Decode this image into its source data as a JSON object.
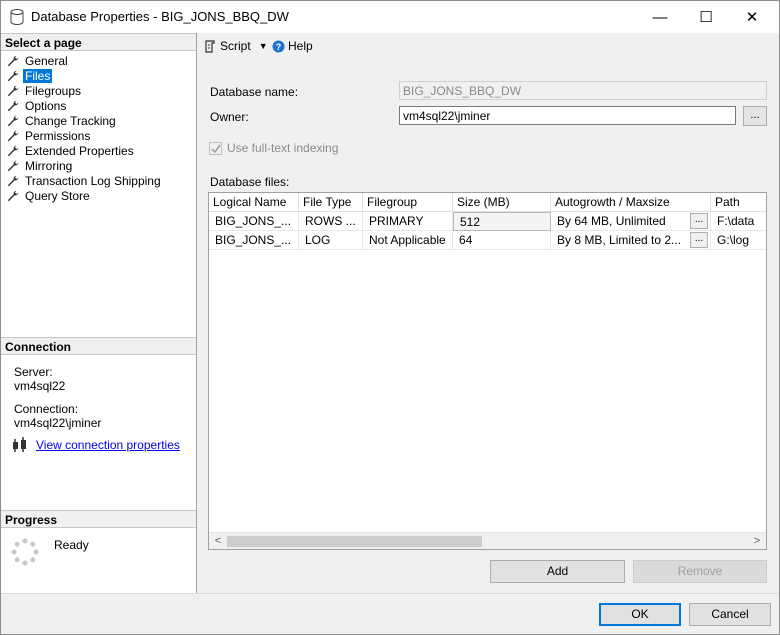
{
  "window": {
    "title": "Database Properties - BIG_JONS_BBQ_DW",
    "minimize": "—",
    "maximize": "☐",
    "close": "✕"
  },
  "left": {
    "select_header": "Select a page",
    "pages": [
      {
        "label": "General",
        "selected": false
      },
      {
        "label": "Files",
        "selected": true
      },
      {
        "label": "Filegroups",
        "selected": false
      },
      {
        "label": "Options",
        "selected": false
      },
      {
        "label": "Change Tracking",
        "selected": false
      },
      {
        "label": "Permissions",
        "selected": false
      },
      {
        "label": "Extended Properties",
        "selected": false
      },
      {
        "label": "Mirroring",
        "selected": false
      },
      {
        "label": "Transaction Log Shipping",
        "selected": false
      },
      {
        "label": "Query Store",
        "selected": false
      }
    ],
    "connection_header": "Connection",
    "server_label": "Server:",
    "server_value": "vm4sql22",
    "connection_label": "Connection:",
    "connection_value": "vm4sql22\\jminer",
    "view_link": "View connection properties",
    "progress_header": "Progress",
    "progress_status": "Ready"
  },
  "toolbar": {
    "script_label": "Script",
    "help_label": "Help"
  },
  "form": {
    "db_name_label": "Database name:",
    "db_name_value": "BIG_JONS_BBQ_DW",
    "owner_label": "Owner:",
    "owner_value": "vm4sql22\\jminer",
    "owner_browse": "...",
    "fulltext_label": "Use full-text indexing",
    "fulltext_checked": true,
    "files_label": "Database files:"
  },
  "grid": {
    "columns": [
      "Logical Name",
      "File Type",
      "Filegroup",
      "Size (MB)",
      "Autogrowth / Maxsize",
      "Path"
    ],
    "rows": [
      {
        "logical": "BIG_JONS_...",
        "type": "ROWS ...",
        "filegroup": "PRIMARY",
        "size": "512",
        "autogrowth": "By 64 MB, Unlimited",
        "ellipsis": "...",
        "path": "F:\\data"
      },
      {
        "logical": "BIG_JONS_...",
        "type": "LOG",
        "filegroup": "Not Applicable",
        "size": "64",
        "autogrowth": "By 8 MB, Limited to 2...",
        "ellipsis": "...",
        "path": "G:\\log"
      }
    ],
    "scroll_left": "<",
    "scroll_right": ">"
  },
  "buttons": {
    "add": "Add",
    "remove": "Remove",
    "ok": "OK",
    "cancel": "Cancel"
  }
}
